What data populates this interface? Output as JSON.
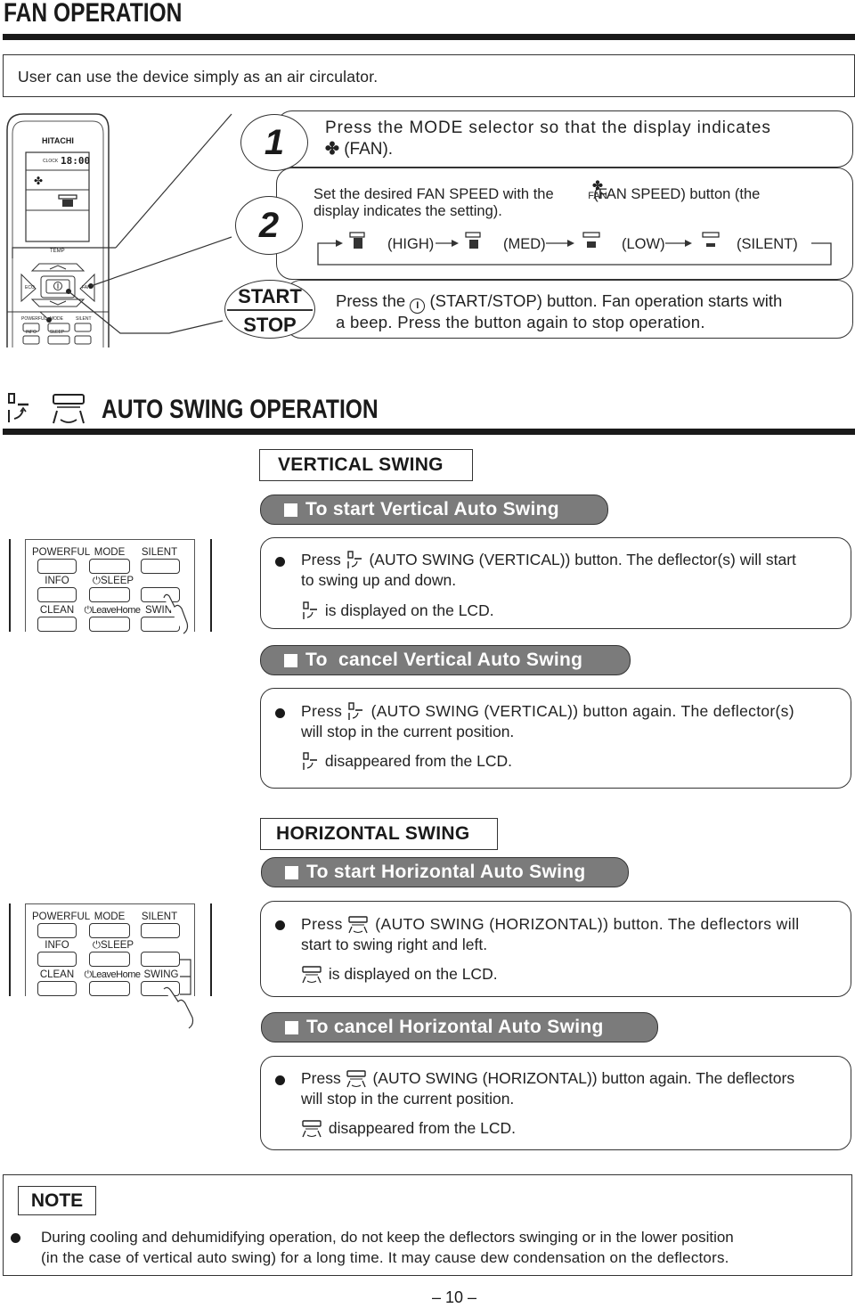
{
  "fan_operation": {
    "title": "FAN OPERATION",
    "intro": "User can use the device simply as an air circulator.",
    "remote": {
      "brand": "HITACHI",
      "clock_label": "CLOCK",
      "clock_time": "18:00",
      "temp_label": "TEMP",
      "eco_label": "ECO",
      "fan_label": "FAN",
      "row_labels": [
        "POWERFUL",
        "MODE",
        "SILENT",
        "INFO",
        "SLEEP"
      ]
    },
    "step1": {
      "number": "1",
      "line1": "Press the MODE selector so that the display indicates",
      "line2": "(FAN).",
      "icon": "fan-icon"
    },
    "step2": {
      "number": "2",
      "line1_a": "Set the desired FAN SPEED with the",
      "fan_button_label": "FAN",
      "line1_b": "(FAN SPEED) button (the",
      "line2": "display indicates the setting).",
      "speeds": [
        "(HIGH)",
        "(MED)",
        "(LOW)",
        "(SILENT)"
      ]
    },
    "start_stop": {
      "start_label": "START",
      "stop_label": "STOP",
      "line1_a": "Press the",
      "line1_b": "(START/STOP) button. Fan operation starts with",
      "line2": "a beep. Press the button again to stop operation.",
      "icon": "power-icon"
    }
  },
  "auto_swing": {
    "title": "AUTO SWING OPERATION",
    "vertical": {
      "heading": "VERTICAL SWING",
      "start_pill": "To start Vertical Auto Swing",
      "start_line1_a": "Press",
      "start_line1_b": "(AUTO SWING (VERTICAL)) button. The deflector(s) will start",
      "start_line2": "to swing up and down.",
      "start_line3": "is displayed on the LCD.",
      "cancel_pill": "To  cancel Vertical Auto Swing",
      "cancel_line1_a": "Press",
      "cancel_line1_b": "(AUTO SWING (VERTICAL)) button again. The deflector(s)",
      "cancel_line2": "will stop in the current position.",
      "cancel_line3": "disappeared from the LCD."
    },
    "horizontal": {
      "heading": "HORIZONTAL SWING",
      "start_pill": "To start Horizontal Auto Swing",
      "start_line1_a": "Press",
      "start_line1_b": "(AUTO SWING (HORIZONTAL)) button. The deflectors will",
      "start_line2": "start to swing right and left.",
      "start_line3": "is displayed on the LCD.",
      "cancel_pill": "To cancel Horizontal Auto Swing",
      "cancel_line1_a": "Press",
      "cancel_line1_b": "(AUTO SWING (HORIZONTAL)) button again. The deflectors",
      "cancel_line2": "will stop in the current position.",
      "cancel_line3": "disappeared from the LCD."
    },
    "remote_panel": {
      "labels": [
        "POWERFUL",
        "MODE",
        "SILENT",
        "INFO",
        "SLEEP",
        "CLEAN",
        "LeaveHome",
        "SWING"
      ],
      "swing_label_partial": "SWIN"
    }
  },
  "note": {
    "label": "NOTE",
    "line1": "During cooling and dehumidifying operation, do not keep the deflectors swinging or in the lower position",
    "line2": "(in the case of vertical auto swing) for a long time. It may cause dew condensation on the deflectors."
  },
  "page_number": "– 10 –"
}
